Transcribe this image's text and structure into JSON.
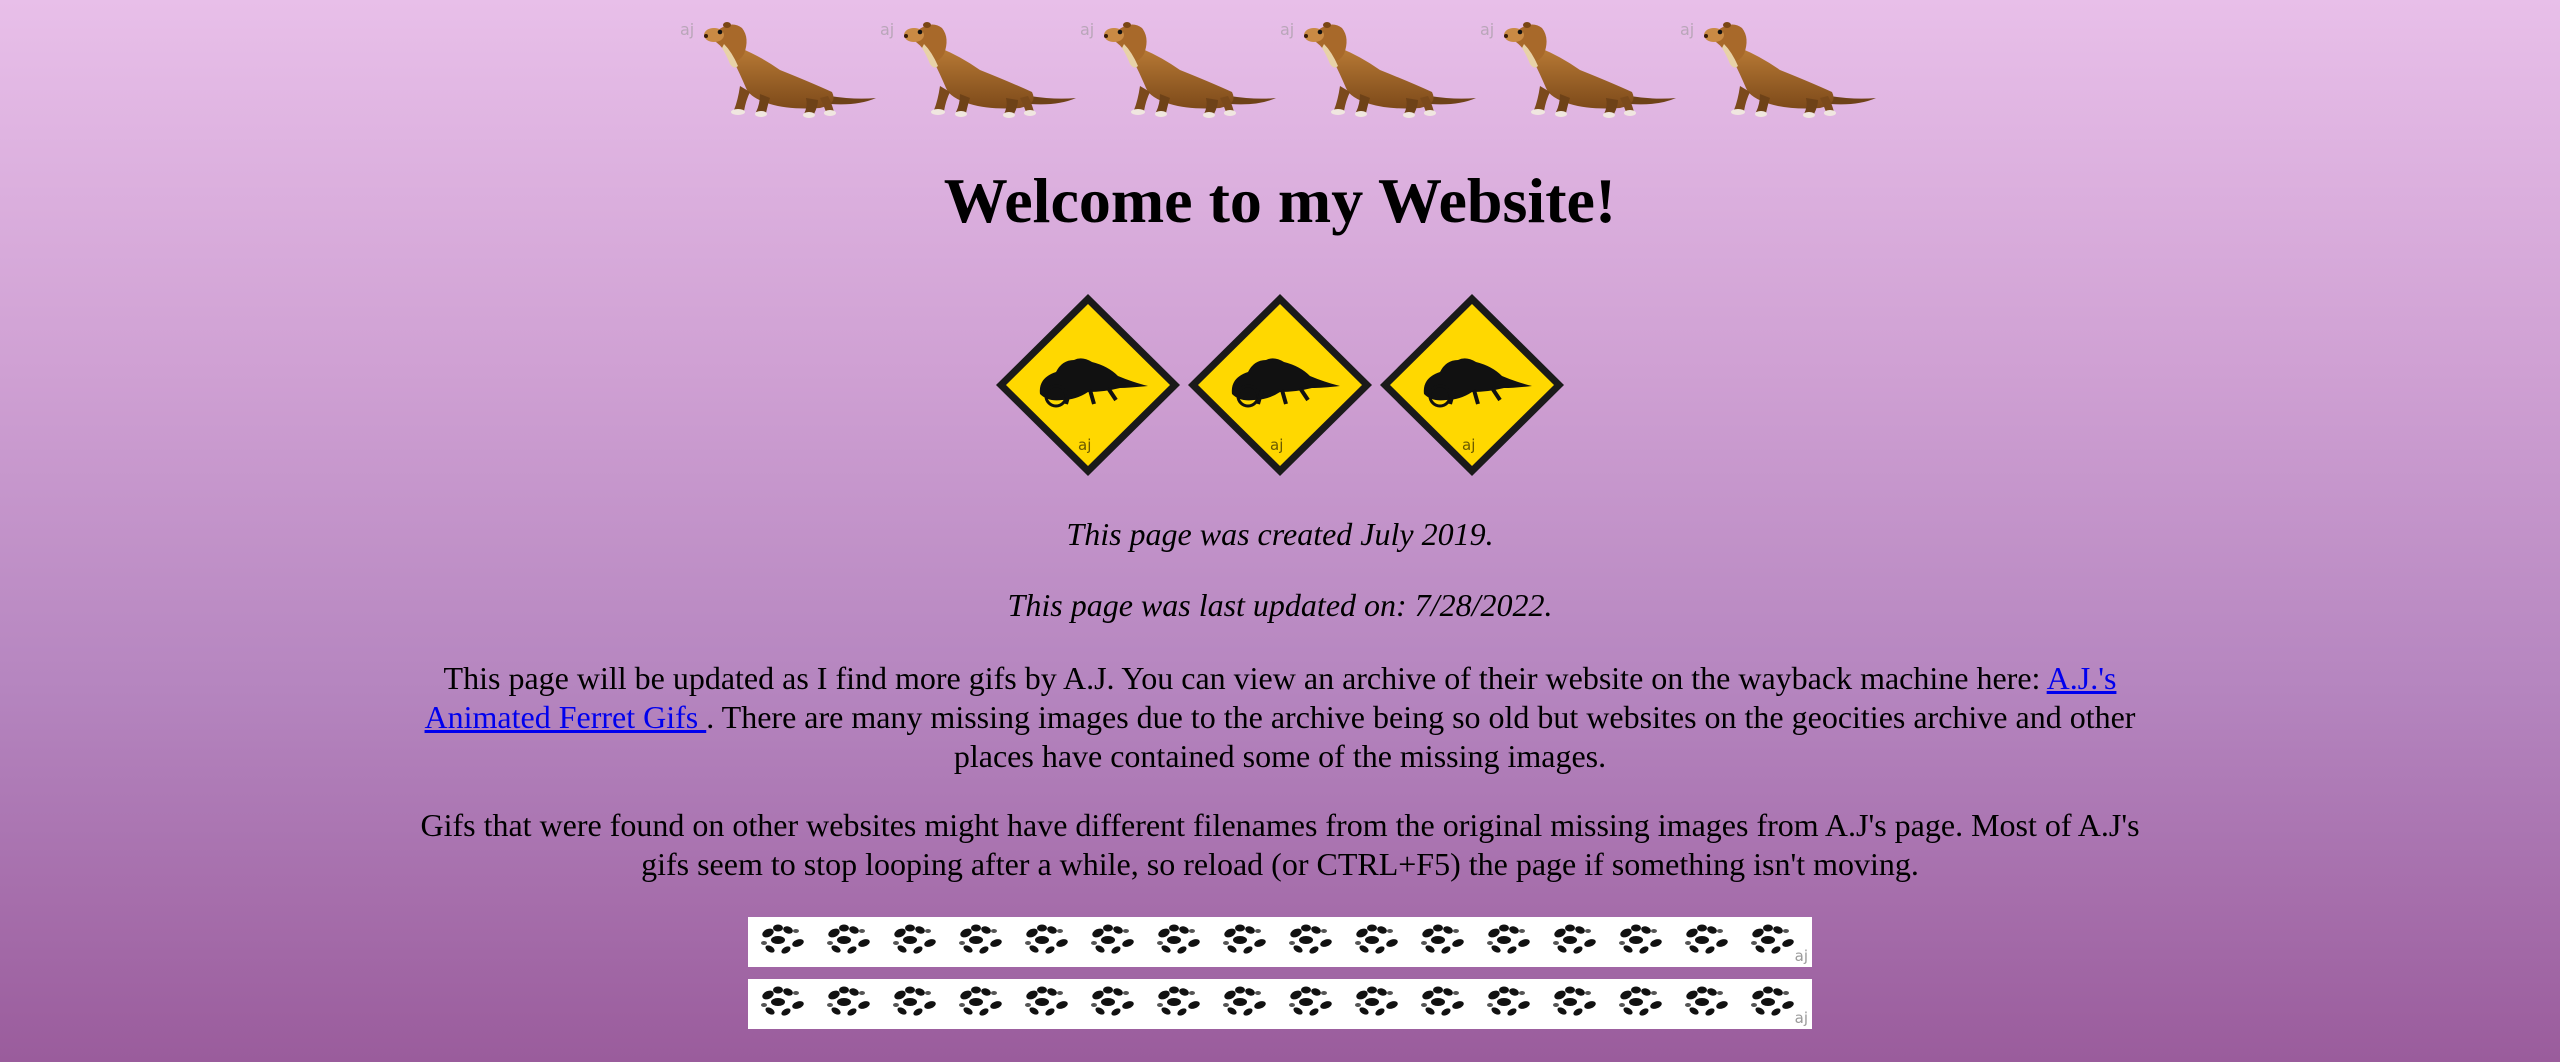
{
  "header": {
    "ferret_count": 6,
    "watermark": "aj"
  },
  "title": "Welcome to my Website!",
  "warning_signs": {
    "count": 3,
    "mark": "aj"
  },
  "created_line": "This page was created July 2019.",
  "updated_line": "This page was last updated on: 7/28/2022.",
  "intro": {
    "before_link": "This page will be updated as I find more gifs by A.J. You can view an archive of their website on the wayback machine here: ",
    "link_text": "A.J.'s Animated Ferret Gifs ",
    "after_link": ". There are many missing images due to the archive being so old but websites on the geocities archive and other places have contained some of the missing images."
  },
  "note": "Gifs that were found on other websites might have different filenames from the original missing images from A.J's page. Most of A.J's gifs seem to stop looping after a while, so reload (or CTRL+F5) the page if something isn't moving.",
  "paw_bars": {
    "count": 2,
    "mark": "aj"
  },
  "colors": {
    "link": "#0000ee",
    "sign_yellow": "#ffd700",
    "ferret_brown": "#9b6124"
  }
}
